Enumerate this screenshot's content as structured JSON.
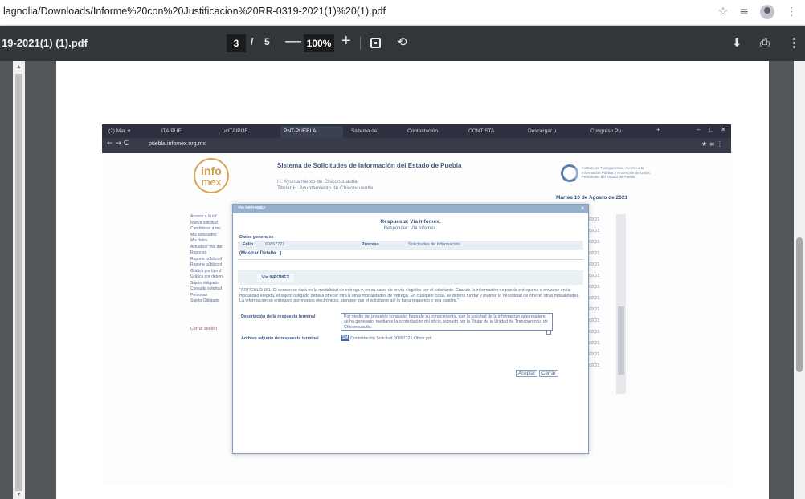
{
  "browser": {
    "url": "lagnolia/Downloads/Informe%20con%20Justificacion%20RR-0319-2021(1)%20(1).pdf",
    "icons": [
      "star-icon",
      "reading-list-icon",
      "profile-icon",
      "more-icon"
    ]
  },
  "pdf_toolbar": {
    "file_name": "19-2021(1) (1).pdf",
    "current_page": "3",
    "page_separator": "/",
    "total_pages": "5",
    "zoom_minus": "—",
    "zoom": "100%",
    "zoom_plus": "+"
  },
  "scan": {
    "tabs": [
      {
        "label": "(2) Mar ✦",
        "active": false
      },
      {
        "label": "ITAIPUE",
        "active": false
      },
      {
        "label": "ucITAIPUE",
        "active": false
      },
      {
        "label": "PNT-PUEBLA",
        "active": true
      },
      {
        "label": "Sistema de",
        "active": false
      },
      {
        "label": "Contestación",
        "active": false
      },
      {
        "label": "CONTISTA",
        "active": false
      },
      {
        "label": "Descargar u",
        "active": false
      },
      {
        "label": "Congreso Pu",
        "active": false
      }
    ],
    "address": "puebla.infomex.org.mx",
    "logo_top": "info",
    "logo_bottom": "mex",
    "system_title": "Sistema de Solicitudes de Información del Estado de Puebla",
    "ayuntamiento": "H. Ayuntamiento de Chiconcuautla",
    "titular": "Titular H. Ayuntamiento de Chiconcuautla",
    "right_logo_text": "Instituto de Transparencia, Acceso a la Información Pública y Protección de Datos Personales del Estado de Puebla",
    "date": "Martes 10 de Agosto de 2021",
    "side_menu": [
      "Acceso a la inf",
      "Nueva solicitud",
      "Candidatas a rec",
      "Mis solicitudes",
      "Mis datos",
      "Actualizar mis dat",
      "Reportes",
      "Reporte público d",
      "Reporte público d",
      "Gráfica por tipo d",
      "Gráfica por depen",
      "Sujeto obligado",
      "Consulta solicitud",
      "Personas",
      "Sujeto Obligado"
    ],
    "cerrar_sesion": "Cerrar sesión",
    "right_list": [
      "8/2021",
      "8/2021",
      "8/2021",
      "8/2021",
      "8/2021",
      "8/2021",
      "8/2021",
      "8/2021",
      "8/2021",
      "8/2021",
      "8/2021",
      "8/2021",
      "8/2021",
      "8/2021"
    ],
    "modal": {
      "header": "VÍA INFORMEX",
      "respuesta": "Respuesta: Vía Infomex.",
      "responder": "Responder: Vía Infomex.",
      "datos_generales": "Datos generales",
      "folio_label": "Folio",
      "folio_value": "00867721",
      "proceso_label": "Proceso",
      "proceso_value": "Solicitudes de Información",
      "mostrar": "(Mostrar Detalle...)",
      "via_button": "Vía INFOMEX",
      "articulo": "\"ARTÍCULO 151. El acceso se dará en la modalidad de entrega y, en su caso, de envío elegidos por el solicitante. Cuando la información no pueda entregarse o enviarse en la modalidad elegida, el sujeto obligado deberá ofrecer otra u otras modalidades de entrega. En cualquier caso, se deberá fundar y motivar la necesidad de ofrecer otras modalidades. La información se entregará por medios electrónicos, siempre que el solicitante así lo haya requerido y sea posible.\"",
      "descripcion_label": "Descripción de la respuesta terminal",
      "descripcion_value": "Por medio del presente conducto, hago de su conocimiento, que la solicitud de la información que requiere, se ha generado, mediante la contestación del oficio, signado por la Titular de la Unidad de Transparencia de Chiconcuautla.",
      "archivo_label": "Archivo adjunto de respuesta terminal",
      "archivo_value": "Contestación Solicitud 00867721 Oficio.pdf",
      "aceptar": "Aceptar",
      "cerrar": "Cerrar"
    }
  }
}
